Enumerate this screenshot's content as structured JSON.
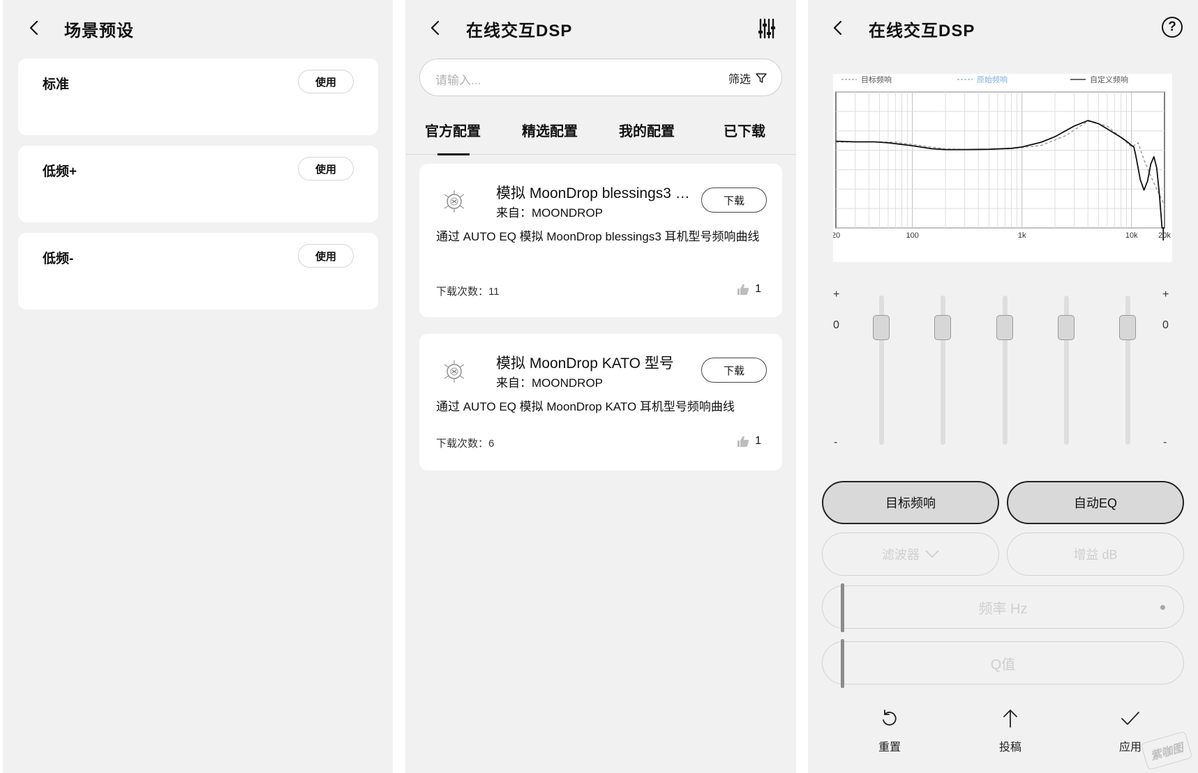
{
  "scene_panel": {
    "title": "场景预设",
    "items": [
      {
        "label": "标准",
        "button": "使用"
      },
      {
        "label": "低频+",
        "button": "使用"
      },
      {
        "label": "低频-",
        "button": "使用"
      }
    ]
  },
  "list_panel": {
    "title": "在线交互DSP",
    "search_placeholder": "请输入...",
    "filter_label": "筛选",
    "tabs": [
      "官方配置",
      "精选配置",
      "我的配置",
      "已下载"
    ],
    "active_tab": "官方配置",
    "cards": [
      {
        "title": "模拟 MoonDrop blessings3 …",
        "from": "来自：MOONDROP",
        "button": "下载",
        "desc": "通过 AUTO EQ 模拟 MoonDrop blessings3 耳机型号频响曲线",
        "count": "下载次数：11",
        "likes": "1"
      },
      {
        "title": "模拟 MoonDrop KATO 型号",
        "from": "来自：MOONDROP",
        "button": "下载",
        "desc": "通过 AUTO EQ 模拟 MoonDrop KATO 耳机型号频响曲线",
        "count": "下载次数：6",
        "likes": "1"
      }
    ]
  },
  "eq_panel": {
    "title": "在线交互DSP",
    "help_symbol": "?",
    "eq_plus": "+",
    "eq_zero": "0",
    "eq_minus": "-",
    "slider_count": 5,
    "buttons": {
      "target": "目标频响",
      "auto_eq": "自动EQ",
      "filter": "滤波器",
      "gain": "增益  dB",
      "freq": "频率  Hz",
      "q": "Q值"
    },
    "actions": [
      {
        "label": "重置",
        "icon": "reset-icon"
      },
      {
        "label": "投稿",
        "icon": "upload-arrow-icon"
      },
      {
        "label": "应用",
        "icon": "check-icon"
      }
    ],
    "watermark": "紫咖图"
  },
  "chart_data": {
    "type": "line",
    "title": "",
    "xlabel": "",
    "ylabel": "",
    "x_scale": "log",
    "xlim": [
      20,
      20000
    ],
    "ylim": [
      -24,
      18
    ],
    "x_ticks": [
      {
        "value": 20,
        "label": "20"
      },
      {
        "value": 100,
        "label": "100"
      },
      {
        "value": 1000,
        "label": "1k"
      },
      {
        "value": 10000,
        "label": "10k"
      },
      {
        "value": 20000,
        "label": "20k"
      }
    ],
    "y_ticks": [
      18,
      12,
      6,
      0,
      -6,
      -12,
      -18,
      -24
    ],
    "grid": true,
    "legend_position": "top",
    "series": [
      {
        "name": "目标频响",
        "color": "#9a9a9a",
        "style": "dashed",
        "x": [
          20,
          40,
          70,
          100,
          200,
          400,
          800,
          1500,
          2500,
          4000,
          6000,
          8000,
          10000,
          11500,
          13000,
          15000,
          17000,
          20000
        ],
        "y": [
          2.5,
          2.6,
          2.5,
          1.8,
          0.4,
          0.2,
          0.5,
          1.5,
          4.5,
          9.0,
          7.5,
          4.0,
          1.0,
          2.3,
          -3.0,
          -8.0,
          -12.0,
          -17.0
        ]
      },
      {
        "name": "原始频响",
        "color": "#7fb0d9",
        "style": "dashed",
        "x": [],
        "y": []
      },
      {
        "name": "自定义频响",
        "color": "#111111",
        "style": "solid",
        "x": [
          20,
          30,
          45,
          60,
          80,
          100,
          150,
          200,
          300,
          500,
          800,
          1000,
          1500,
          2000,
          3000,
          4000,
          5000,
          6000,
          8000,
          9000,
          10000,
          10500,
          11000,
          12000,
          13000,
          14000,
          15000,
          16000,
          17000,
          18000,
          19000,
          20000
        ],
        "y": [
          2.8,
          2.6,
          2.6,
          2.3,
          1.8,
          1.4,
          0.5,
          0.2,
          0.2,
          0.3,
          0.6,
          1.0,
          2.5,
          4.2,
          7.5,
          9.2,
          8.2,
          6.6,
          4.0,
          2.8,
          1.5,
          1.0,
          -2.0,
          -9.0,
          -12.3,
          -9.5,
          -4.2,
          -2.0,
          -5.5,
          -14.0,
          -24.0,
          -24.0
        ]
      }
    ]
  }
}
